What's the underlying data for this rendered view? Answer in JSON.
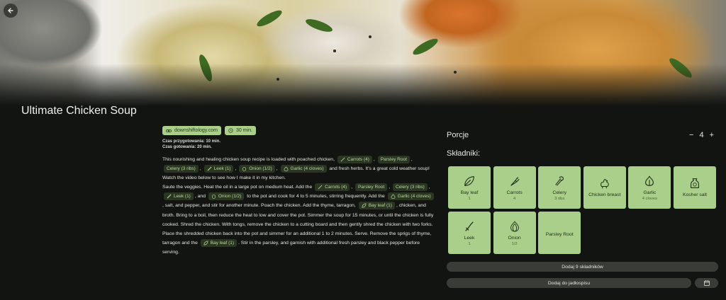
{
  "recipe": {
    "title": "Ultimate Chicken Soup",
    "source_chip": "downshiftology.com",
    "time_chip": "30 min.",
    "prep_time": "Czas przygotowania: 10 min.",
    "cook_time": "Czas gotowania: 20 min."
  },
  "desc": {
    "p1a": "This nourishing and healing chicken soup recipe is loaded with poached chicken,",
    "carrots": "Carrots (4)",
    "parsley_root": "Parsley Root",
    "celery": "Celery (3 ribs)",
    "leek": "Leek (1)",
    "onion": "Onion (1/2)",
    "garlic": "Garlic (4 cloves)",
    "p1b": "and fresh herbs. It's a great cold weather soup! Watch the video below to see how I make it in my kitchen.",
    "p2a": "Saute the veggies. Heat the oil in a large pot on medium heat. Add the",
    "and": "and",
    "p2b": "to the pot and cook for 4 to 5 minutes, stirring frequently. Add the",
    "p2c": ", salt, and pepper, and stir for another minute. Poach the chicken. Add the thyme, tarragon,",
    "bay_leaf": "Bay leaf (1)",
    "p2d": ", chicken, and broth. Bring to a boil, then reduce the heat to low and cover the pot. Simmer the soup for 15 minutes, or until the chicken is fully cooked. Shred the chicken. With tongs, remove the chicken to a cutting board and then gently shred the chicken with two forks. Place the shredded chicken back into the pot and simmer for an additional 1 to 2 minutes. Serve. Remove the sprigs of thyme, tarragon and the",
    "p2e": ". Stir in the parsley, and garnish with additional fresh parsley and black pepper before serving."
  },
  "side": {
    "porcje_label": "Porcje",
    "servings": "4",
    "minus": "−",
    "plus": "+",
    "skladniki_label": "Składniki:",
    "add_ingredients": "Dodaj 9 składników",
    "add_to_plan": "Dodaj do jadłospisu"
  },
  "ingredients": [
    {
      "name": "Bay leaf",
      "qty": "1",
      "icon": "bay-leaf-icon"
    },
    {
      "name": "Carrots",
      "qty": "4",
      "icon": "carrot-icon"
    },
    {
      "name": "Celery",
      "qty": "3 ribs",
      "icon": "celery-icon"
    },
    {
      "name": "Chicken breast",
      "qty": "",
      "icon": "chicken-icon"
    },
    {
      "name": "Garlic",
      "qty": "4 cloves",
      "icon": "garlic-icon"
    },
    {
      "name": "Kosher salt",
      "qty": "",
      "icon": "salt-icon"
    },
    {
      "name": "Leek",
      "qty": "1",
      "icon": "leek-icon"
    },
    {
      "name": "Onion",
      "qty": "1/2",
      "icon": "onion-icon"
    },
    {
      "name": "Parsley Root",
      "qty": "",
      "icon": ""
    }
  ],
  "colors": {
    "accent": "#a9cf8a",
    "background": "#121411",
    "chip_dark": "#2a3622"
  }
}
